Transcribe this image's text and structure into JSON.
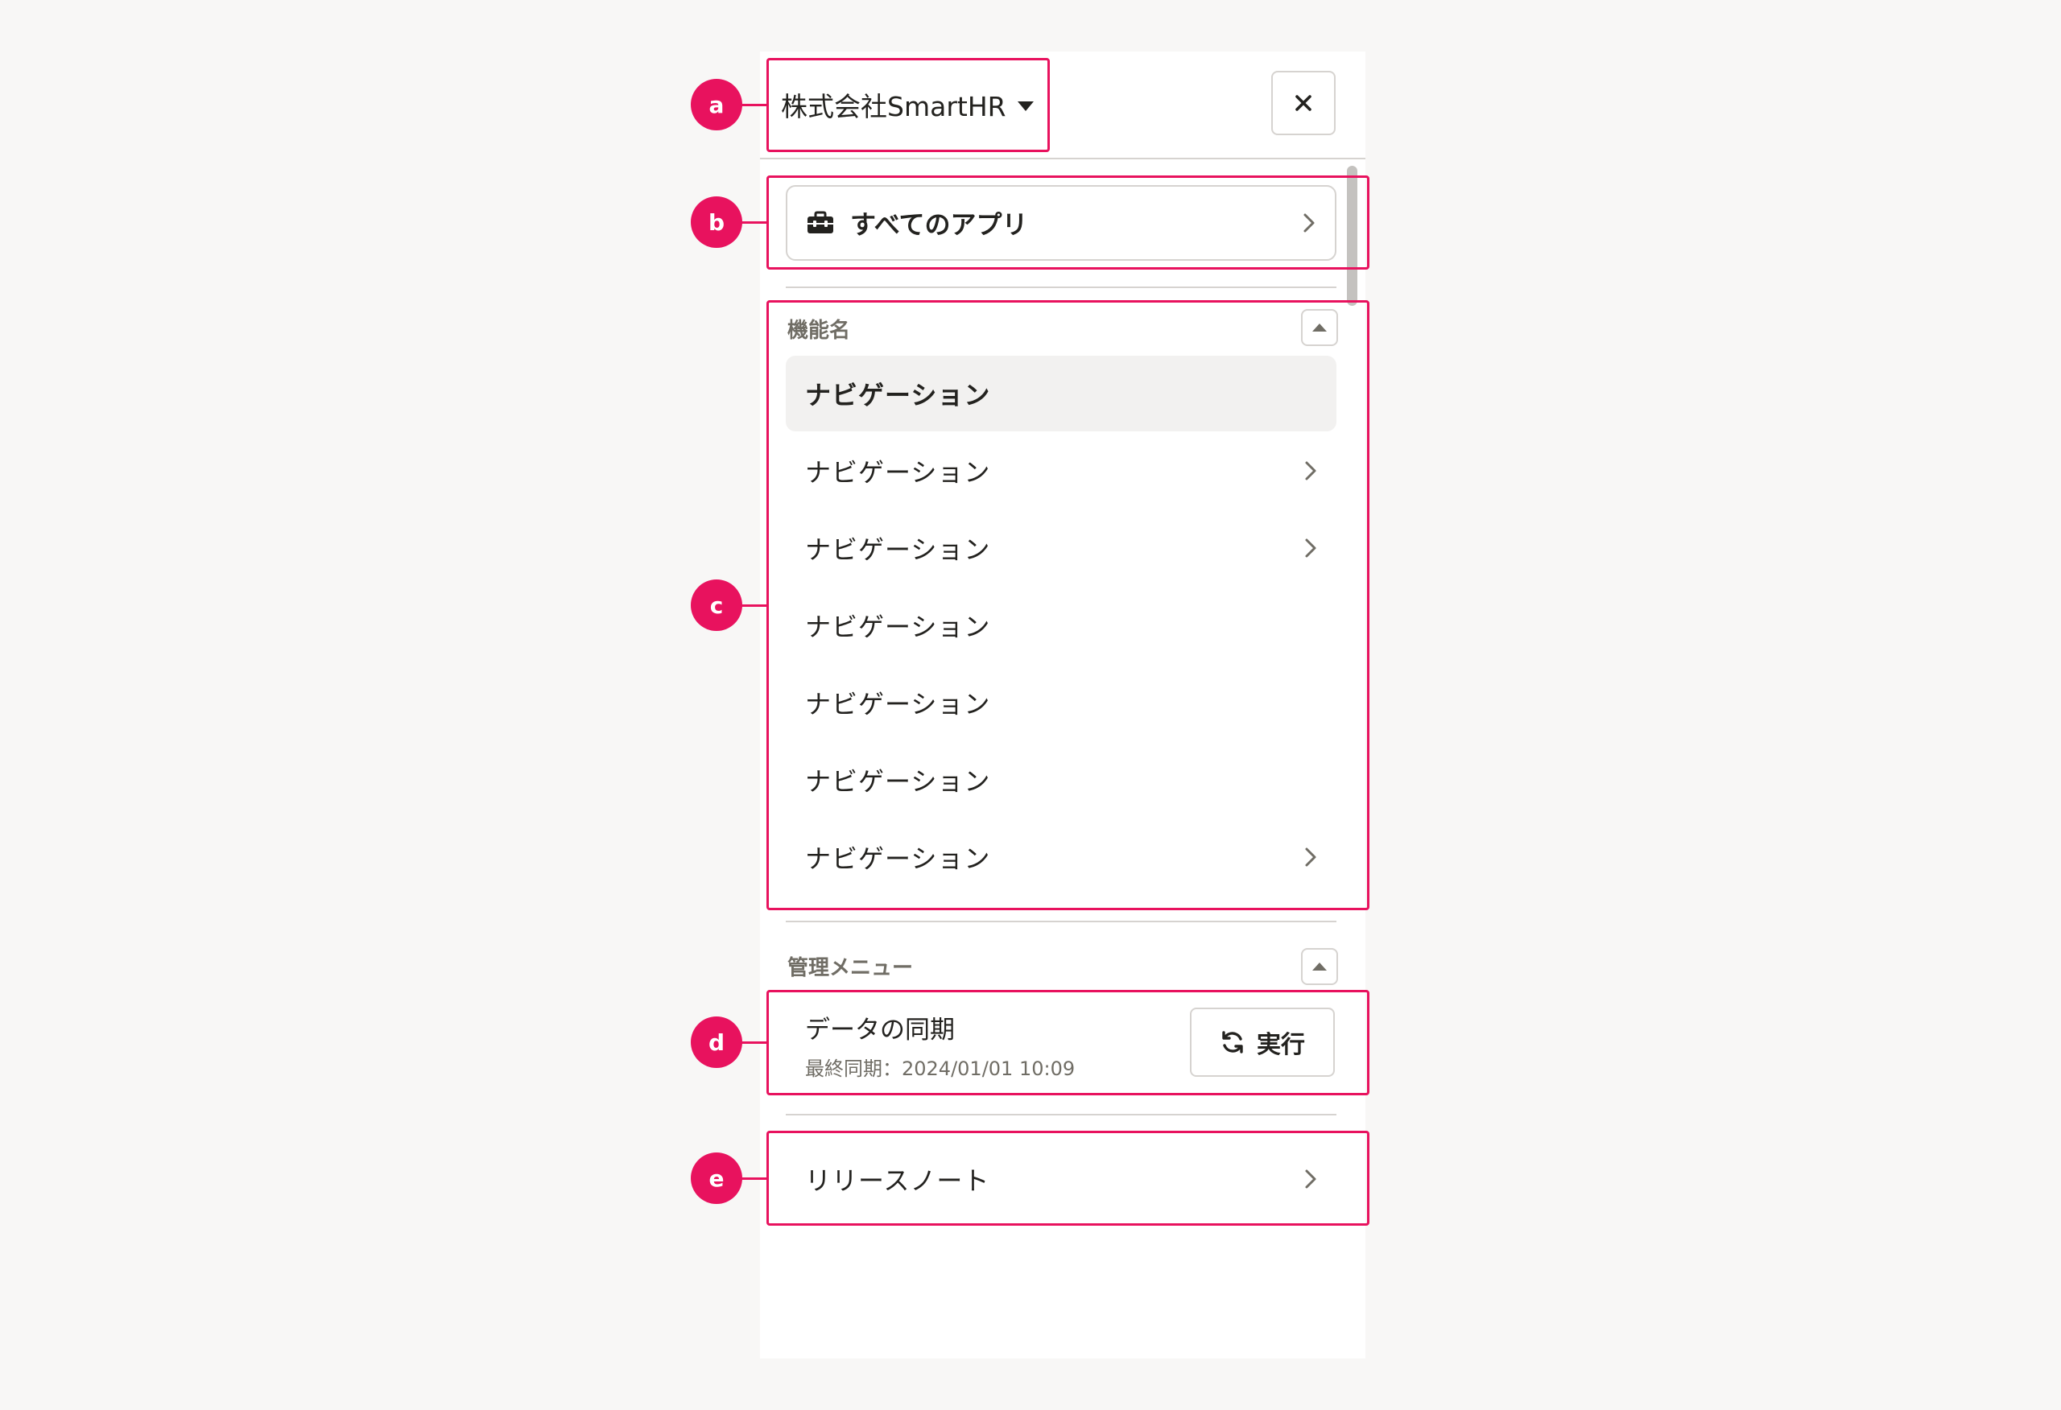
{
  "header": {
    "company_name": "株式会社SmartHR",
    "close_icon": "close-icon",
    "dropdown_icon": "caret-down-icon"
  },
  "apps_button": {
    "label": "すべてのアプリ",
    "icon": "toolbox-icon"
  },
  "feature_group": {
    "title": "機能名",
    "items": [
      {
        "label": "ナビゲーション",
        "active": true,
        "has_arrow": false
      },
      {
        "label": "ナビゲーション",
        "active": false,
        "has_arrow": true
      },
      {
        "label": "ナビゲーション",
        "active": false,
        "has_arrow": true
      },
      {
        "label": "ナビゲーション",
        "active": false,
        "has_arrow": false
      },
      {
        "label": "ナビゲーション",
        "active": false,
        "has_arrow": false
      },
      {
        "label": "ナビゲーション",
        "active": false,
        "has_arrow": false
      },
      {
        "label": "ナビゲーション",
        "active": false,
        "has_arrow": true
      }
    ]
  },
  "admin_group": {
    "title": "管理メニュー",
    "sync": {
      "title": "データの同期",
      "last_synced": "最終同期：2024/01/01 10:09",
      "button_label": "実行"
    }
  },
  "release_notes": {
    "label": "リリースノート"
  },
  "annotations": [
    "a",
    "b",
    "c",
    "d",
    "e"
  ],
  "colors": {
    "highlight": "#e8125e",
    "text": "#23221f",
    "muted": "#706d65",
    "border": "#d6d3d0",
    "active_bg": "#f2f1f0"
  }
}
